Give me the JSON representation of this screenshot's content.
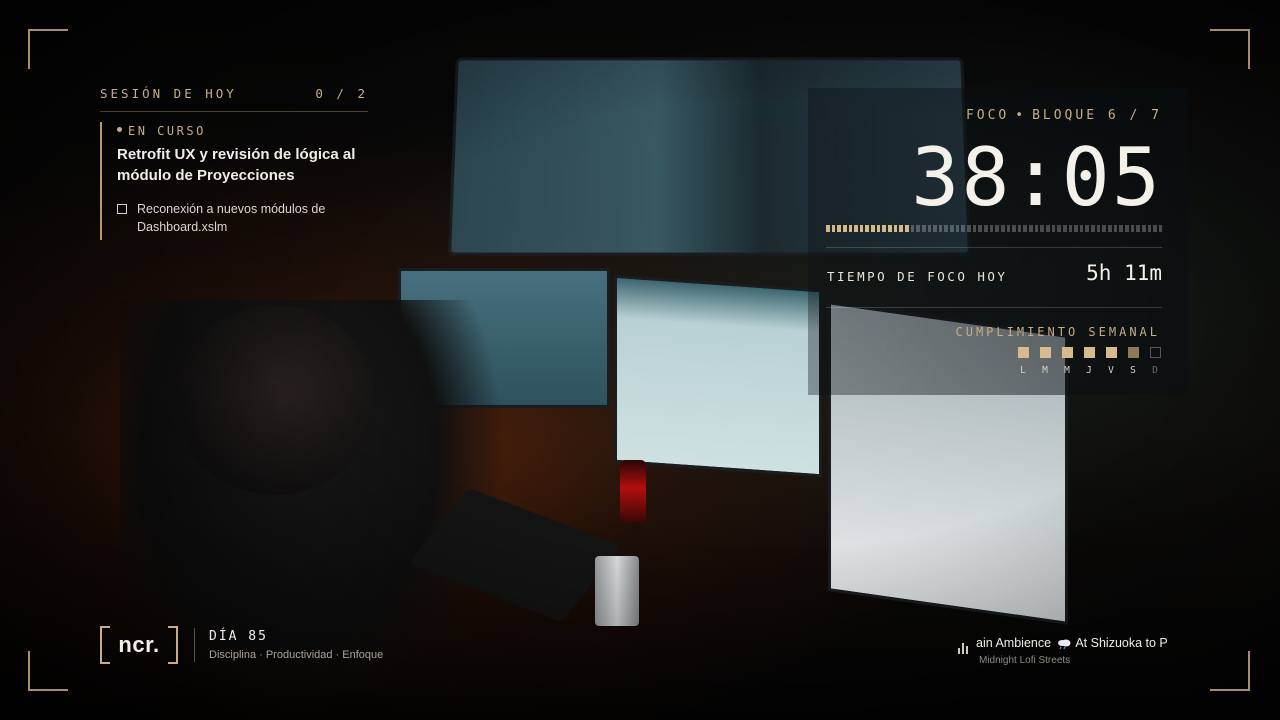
{
  "session": {
    "title": "SESIÓN DE HOY",
    "count": "0 / 2",
    "status": "EN CURSO",
    "current_task": "Retrofit UX y revisión de lógica al módulo de Proyecciones",
    "subtask": "Reconexión a nuevos módulos de Dashboard.xslm"
  },
  "focus": {
    "label": "FOCO",
    "block": "BLOQUE 6 / 7",
    "timer": "38:05",
    "progress": 0.25,
    "today_label": "TIEMPO DE FOCO HOY",
    "today_value": "5h 11m",
    "weekly_label": "CUMPLIMIENTO SEMANAL",
    "weekly_days": [
      {
        "letter": "L",
        "state": "done"
      },
      {
        "letter": "M",
        "state": "done"
      },
      {
        "letter": "M",
        "state": "done"
      },
      {
        "letter": "J",
        "state": "done"
      },
      {
        "letter": "V",
        "state": "done"
      },
      {
        "letter": "S",
        "state": "partial"
      },
      {
        "letter": "D",
        "state": "empty"
      }
    ]
  },
  "brand": {
    "logo": "ncr.",
    "day": "DÍA 85",
    "tagline": "Disciplina · Productividad · Enfoque"
  },
  "music": {
    "track_part1": "ain Ambience",
    "track_part2": "At Shizuoka to P",
    "artist": "Midnight Lofi Streets",
    "icon": "rain-cloud-icon"
  },
  "colors": {
    "accent": "#c6ad84",
    "progress_fill": "#d6b98a",
    "text": "#f4f1ea"
  }
}
